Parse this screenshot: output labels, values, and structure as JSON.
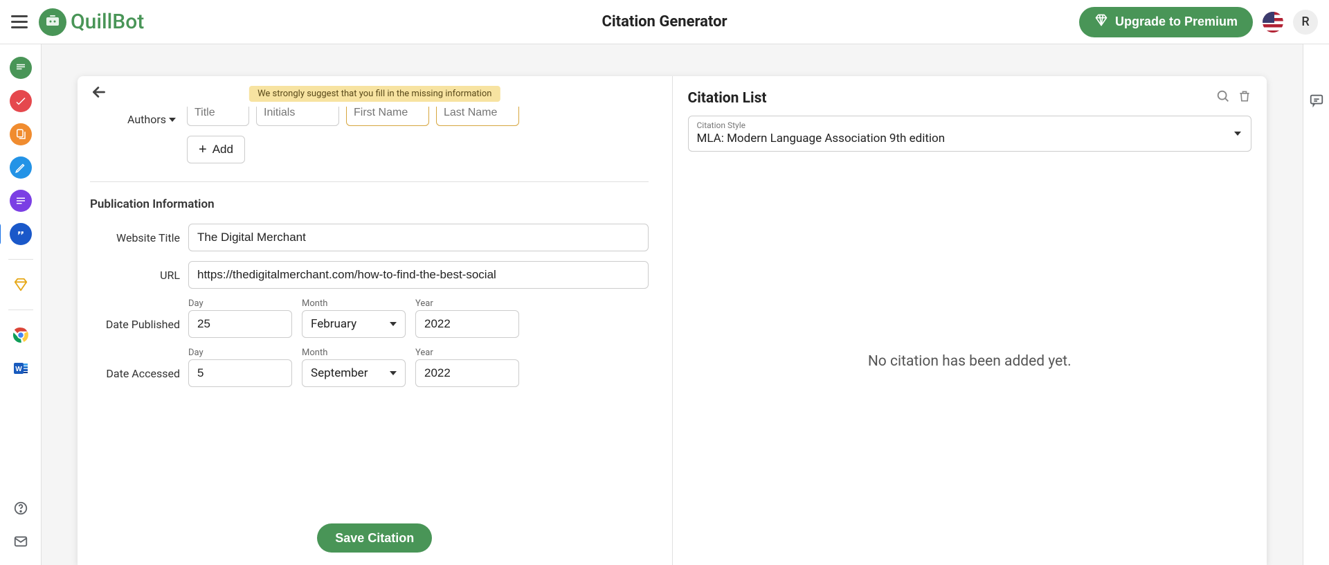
{
  "header": {
    "title": "Citation Generator",
    "upgrade": "Upgrade to Premium",
    "avatar_initial": "R",
    "brand": "QuillBot"
  },
  "hint": "We strongly suggest that you fill in the missing information",
  "authors": {
    "label": "Authors",
    "title_ph": "Title",
    "initials_ph": "Initials",
    "first_ph": "First Name",
    "last_ph": "Last Name",
    "add": "Add"
  },
  "pub": {
    "section": "Publication Information",
    "website_label": "Website Title",
    "website_value": "The Digital Merchant",
    "url_label": "URL",
    "url_value": "https://thedigitalmerchant.com/how-to-find-the-best-social",
    "date_pub_label": "Date Published",
    "date_acc_label": "Date Accessed",
    "day_label": "Day",
    "month_label": "Month",
    "year_label": "Year",
    "pub_day": "25",
    "pub_month": "February",
    "pub_year": "2022",
    "acc_day": "5",
    "acc_month": "September",
    "acc_year": "2022"
  },
  "save": "Save Citation",
  "list": {
    "title": "Citation List",
    "style_label": "Citation Style",
    "style_value": "MLA: Modern Language Association 9th edition",
    "empty": "No citation has been added yet."
  }
}
